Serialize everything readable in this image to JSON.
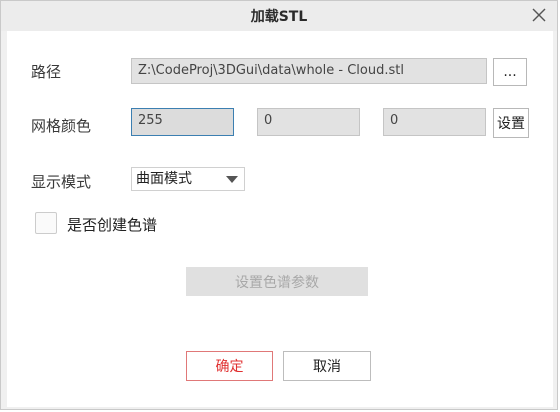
{
  "window": {
    "title": "加载STL",
    "close_icon": "close-icon"
  },
  "path": {
    "label": "路径",
    "value": "Z:\\CodeProj\\3DGui\\data\\whole - Cloud.stl",
    "browse_label": "..."
  },
  "color": {
    "label": "网格颜色",
    "r": "255",
    "g": "0",
    "b": "0",
    "set_label": "设置"
  },
  "mode": {
    "label": "显示模式",
    "selected": "曲面模式"
  },
  "colormap": {
    "checkbox_label": "是否创建色谱",
    "checked": false,
    "params_button": "设置色谱参数"
  },
  "footer": {
    "ok_label": "确定",
    "cancel_label": "取消"
  },
  "colors": {
    "accent_red": "#e03030",
    "focus_blue": "#3c7fb1"
  }
}
